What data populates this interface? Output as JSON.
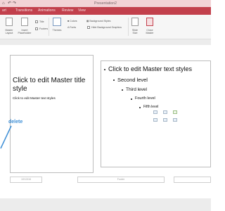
{
  "app": {
    "title": "Presentation2"
  },
  "tabs": [
    "art",
    "Transitions",
    "Animations",
    "Review",
    "View"
  ],
  "ribbon": {
    "master_layout": "Master\nLayout",
    "insert_placeholder": "Insert\nPlaceholder",
    "title_check": "Title",
    "footers_check": "Footers",
    "themes": "Themes",
    "colors": "Colors",
    "fonts": "Fonts",
    "background_styles": "Background Styles",
    "hide_background_graphics": "Hide Background Graphics",
    "slide_size": "Slide\nSize",
    "close_master": "Close\nMaster"
  },
  "slide": {
    "title_placeholder": "Click to edit Master title style",
    "title_sub": "Click to edit Master text styles",
    "body_levels": [
      "Click to edit Master text styles",
      "Second level",
      "Third level",
      "Fourth level",
      "Fifth level"
    ],
    "footer_date": "10/13/16",
    "footer_center": "Footer"
  },
  "annotation": {
    "label": "delete",
    "color": "#3f8fd6"
  },
  "colors": {
    "accent": "#c2404c",
    "titlebar": "#f2d3d6"
  }
}
